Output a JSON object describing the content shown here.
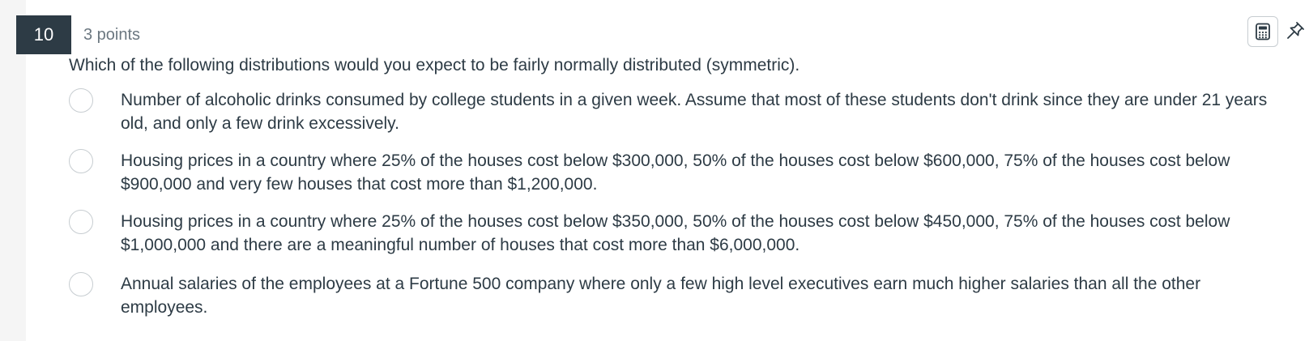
{
  "question": {
    "number": "10",
    "points": "3 points",
    "text": "Which of the following distributions would you expect to be fairly normally distributed (symmetric)."
  },
  "tools": {
    "calculator_icon": "calculator-icon",
    "pin_icon": "pin-icon"
  },
  "answers": [
    {
      "label": "Number of alcoholic drinks consumed by college students in a given week. Assume that most of these students don't drink since they are under 21 years old, and only a few drink excessively.",
      "selected": false
    },
    {
      "label": "Housing prices in a country where 25% of the houses cost below $300,000, 50% of the houses cost below $600,000, 75% of the houses cost below $900,000 and very few houses that cost more than $1,200,000.",
      "selected": false
    },
    {
      "label": "Housing prices in a country where 25% of the houses cost below $350,000, 50% of the houses cost below $450,000, 75% of the houses cost below $1,000,000 and there are a meaningful number of houses that cost more than $6,000,000.",
      "selected": false
    },
    {
      "label": "Annual salaries of the employees at a Fortune 500 company where only a few high level executives earn much higher salaries than all the other employees.",
      "selected": false
    }
  ],
  "colors": {
    "page_background": "#f5f5f5",
    "card_background": "#ffffff",
    "number_badge": "#2d3b45",
    "text": "#2d3b45",
    "muted_text": "#6b7780",
    "radio_border": "#c7cdd1"
  }
}
